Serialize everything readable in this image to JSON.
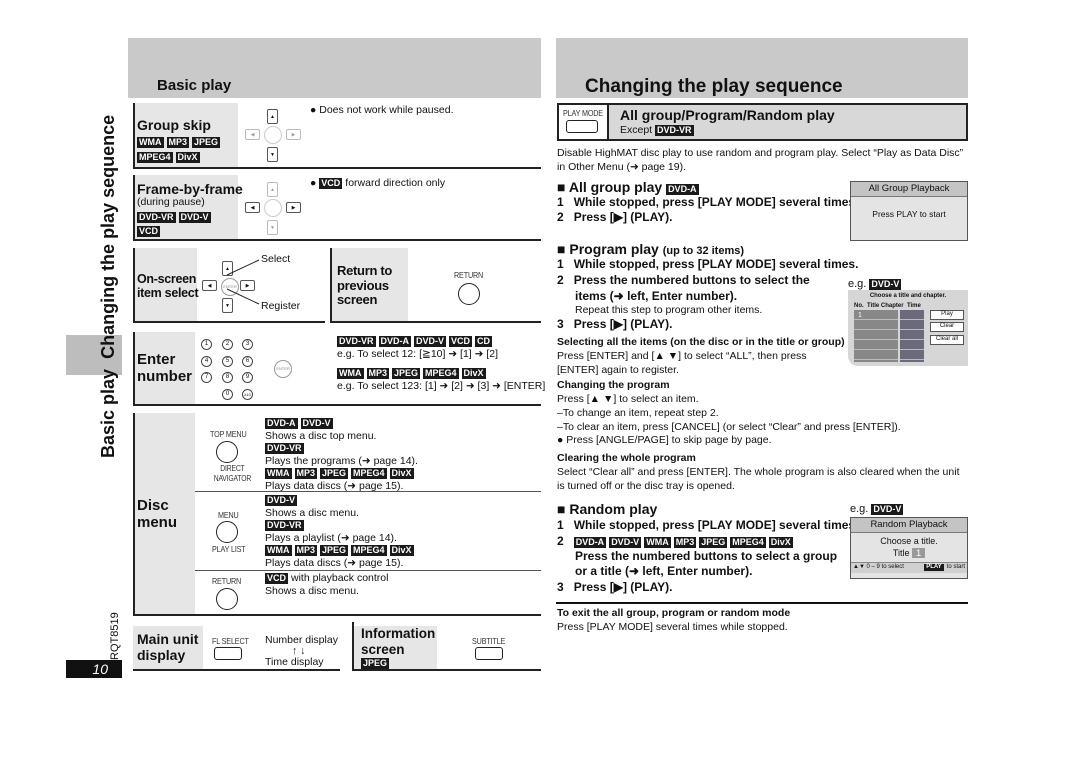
{
  "side": {
    "basic_play": "Basic play",
    "changing": "Changing the play sequence",
    "doc_code": "RQT8519",
    "page_number": "10"
  },
  "left": {
    "title": "Basic play",
    "group_skip": {
      "label": "Group skip",
      "badges": [
        "WMA",
        "MP3",
        "JPEG"
      ],
      "badges2": [
        "MPEG4",
        "DivX"
      ],
      "note": "● Does not work while paused."
    },
    "frame": {
      "label": "Frame-by-frame",
      "sub": "(during pause)",
      "badges": [
        "DVD-VR",
        "DVD-V"
      ],
      "badges2": [
        "VCD"
      ],
      "note_badge": "VCD",
      "note": "forward direction only",
      "bullet": "●"
    },
    "onscreen": {
      "label1": "On-screen",
      "label2": "item select",
      "select": "Select",
      "register": "Register",
      "enter_key": "ENTER"
    },
    "return_prev": {
      "label1": "Return to",
      "label2": "previous",
      "label3": "screen",
      "button": "RETURN"
    },
    "enter_number": {
      "label1": "Enter",
      "label2": "number",
      "keys": [
        "1",
        "2",
        "3",
        "4",
        "5",
        "6",
        "7",
        "8",
        "9",
        "0",
        "≥10"
      ],
      "enter_key": "ENTER",
      "badges1": [
        "DVD-VR",
        "DVD-A",
        "DVD-V",
        "VCD",
        "CD"
      ],
      "eg1": "e.g. To select 12: [≧10] ➜ [1] ➜ [2]",
      "badges2": [
        "WMA",
        "MP3",
        "JPEG",
        "MPEG4",
        "DivX"
      ],
      "eg2": "e.g. To select 123: [1] ➜ [2] ➜ [3] ➜ [ENTER]"
    },
    "disc_menu": {
      "label1": "Disc",
      "label2": "menu",
      "top_menu": {
        "button": "TOP MENU",
        "sub": "DIRECT NAVIGATOR",
        "b1": [
          "DVD-A",
          "DVD-V"
        ],
        "t1": "Shows a disc top menu.",
        "b2": [
          "DVD-VR"
        ],
        "t2": "Plays the programs (➜ page 14).",
        "b3": [
          "WMA",
          "MP3",
          "JPEG",
          "MPEG4",
          "DivX"
        ],
        "t3": "Plays data discs (➜ page 15)."
      },
      "menu": {
        "button": "MENU",
        "sub": "PLAY LIST",
        "b1": [
          "DVD-V"
        ],
        "t1": "Shows a disc menu.",
        "b2": [
          "DVD-VR"
        ],
        "t2": "Plays a playlist (➜ page 14).",
        "b3": [
          "WMA",
          "MP3",
          "JPEG",
          "MPEG4",
          "DivX"
        ],
        "t3": "Plays data discs (➜ page 15)."
      },
      "return": {
        "button": "RETURN",
        "b1": [
          "VCD"
        ],
        "t1a": "with playback control",
        "t1": "Shows a disc menu."
      }
    },
    "main_display": {
      "label1": "Main unit",
      "label2": "display",
      "button": "FL SELECT",
      "d1": "Number display",
      "arrows": "↑ ↓",
      "d2": "Time display"
    },
    "info_screen": {
      "label1": "Information",
      "label2": "screen",
      "badges": [
        "JPEG"
      ],
      "button": "SUBTITLE"
    }
  },
  "right": {
    "title": "Changing the play sequence",
    "play_mode": {
      "button": "PLAY MODE",
      "heading": "All group/Program/Random play",
      "except": "Except",
      "except_badge": [
        "DVD-VR"
      ]
    },
    "intro": "Disable HighMAT disc play to use random and program play. Select “Play as Data Disc” in Other Menu (➜ page 19).",
    "all_group": {
      "heading": "All group play",
      "badges": [
        "DVD-A"
      ],
      "s1": "While stopped, press [PLAY MODE] several times.",
      "s2": "Press [▶] (PLAY).",
      "screen_title": "All Group Playback",
      "screen_text": "Press PLAY to start"
    },
    "program": {
      "heading": "Program play",
      "limit": "(up to 32 items)",
      "s1": "While stopped, press [PLAY MODE] several times.",
      "s2a": "Press the numbered buttons to select the",
      "s2b": "items (➜ left, Enter number).",
      "s2note": "Repeat this step to program other items.",
      "s3": "Press [▶] (PLAY).",
      "eg": "e.g.",
      "eg_badge": [
        "DVD-V"
      ],
      "screen_title": "Choose a title and chapter.",
      "cols": [
        "No.",
        "Title",
        "Chapter",
        "Time"
      ],
      "row1": "1",
      "buttons": [
        "Play",
        "Clear",
        "Clear all"
      ],
      "sel_heading": "Selecting all the items (on the disc or in the title or group)",
      "sel_text": "Press [ENTER] and [▲ ▼] to select “ALL”, then press [ENTER] again to register.",
      "chg_heading": "Changing the program",
      "chg_lines": [
        "Press [▲ ▼] to select an item.",
        "–To change an item, repeat step 2.",
        "–To clear an item, press [CANCEL] (or select “Clear” and press [ENTER]).",
        "● Press [ANGLE/PAGE] to skip page by page."
      ],
      "clr_heading": "Clearing the whole program",
      "clr_text": "Select “Clear all” and press [ENTER]. The whole program is also cleared when the unit is turned off or the disc tray is opened."
    },
    "random": {
      "heading": "Random play",
      "s1": "While stopped, press [PLAY MODE] several times.",
      "s2_badges": [
        "DVD-A",
        "DVD-V",
        "WMA",
        "MP3",
        "JPEG",
        "MPEG4",
        "DivX"
      ],
      "s2a": "Press the numbered buttons to select a group",
      "s2b": "or a title (➜ left, Enter number).",
      "s3": "Press [▶] (PLAY).",
      "eg": "e.g.",
      "eg_badge": [
        "DVD-V"
      ],
      "screen_title": "Random Playback",
      "screen_l1": "Choose a title.",
      "screen_title_lbl": "Title",
      "screen_val": "1",
      "foot_l": "▲▼ 0 – 9 to select",
      "foot_key": "PLAY",
      "foot_r": "to start"
    },
    "exit": {
      "heading": "To exit the all group, program or random mode",
      "text": "Press [PLAY MODE] several times while stopped."
    }
  }
}
